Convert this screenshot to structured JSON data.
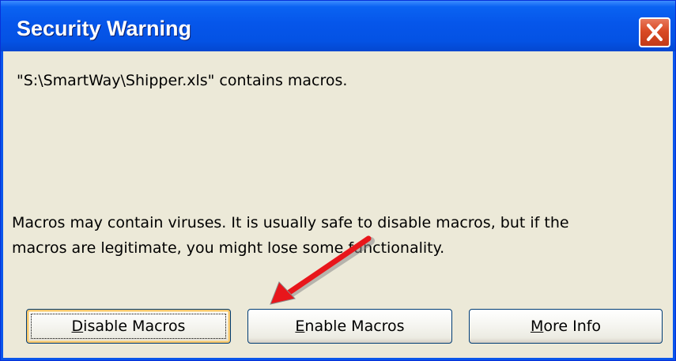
{
  "window": {
    "title": "Security Warning",
    "close_icon": "close-icon"
  },
  "message": {
    "file_notice": "\"S:\\SmartWay\\Shipper.xls\" contains macros.",
    "warning_line1": "Macros may contain viruses. It is usually safe to disable macros, but if the",
    "warning_line2": "macros are legitimate, you might lose some functionality."
  },
  "buttons": {
    "disable": {
      "mnemonic": "D",
      "rest": "isable Macros"
    },
    "enable": {
      "mnemonic": "E",
      "rest": "nable Macros"
    },
    "more_info": {
      "mnemonic": "M",
      "rest": "ore Info"
    }
  },
  "annotation": {
    "icon": "red-arrow-icon",
    "color": "#e8161b"
  },
  "colors": {
    "titlebar": "#0656ea",
    "dialog_bg": "#ece9d8",
    "close_button": "#d94a24"
  }
}
